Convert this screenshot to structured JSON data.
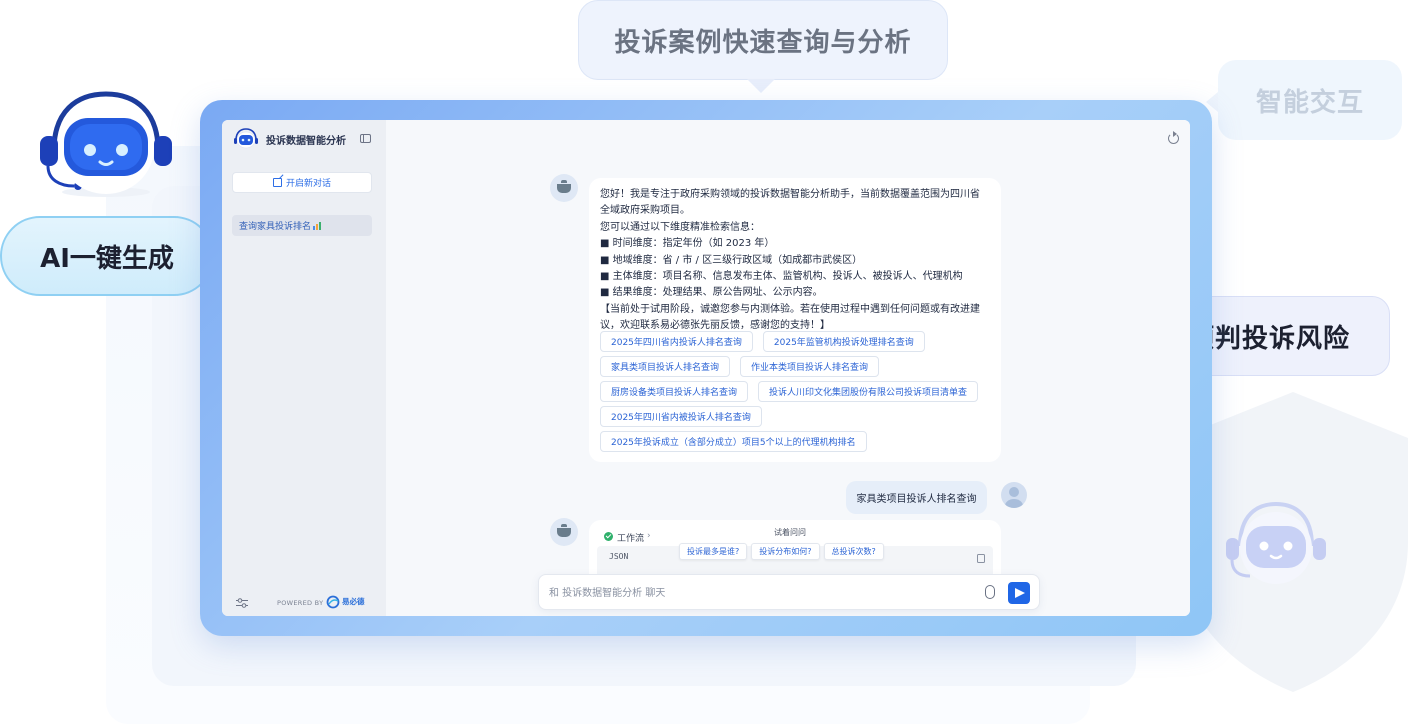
{
  "bubbles": {
    "top": "投诉案例快速查询与分析",
    "smart": "智能交互",
    "ai": "AI一键生成",
    "risk": "预判投诉风险"
  },
  "app": {
    "title": "投诉数据智能分析",
    "new_chat": "开启新对话",
    "history": [
      {
        "label": "查询家具投诉排名"
      }
    ],
    "powered_by": "POWERED BY",
    "brand": "易必德"
  },
  "chat": {
    "greeting": [
      "您好！我是专注于政府采购领域的投诉数据智能分析助手，当前数据覆盖范围为四川省",
      "全域政府采购项目。",
      "您可以通过以下维度精准检索信息：",
      "■ 时间维度：指定年份（如 2023 年）",
      "■ 地域维度：省 / 市 / 区三级行政区域（如成都市武侯区）",
      "■ 主体维度：项目名称、信息发布主体、监管机构、投诉人、被投诉人、代理机构",
      "■ 结果维度：处理结果、原公告网址、公示内容。",
      "【当前处于试用阶段，诚邀您参与内测体验。若在使用过程中遇到任何问题或有改进建",
      "议，欢迎联系易必德张先丽反馈，感谢您的支持！】"
    ],
    "suggestions": [
      [
        "2025年四川省内投诉人排名查询",
        "2025年监管机构投诉处理排名查询"
      ],
      [
        "家具类项目投诉人排名查询",
        "作业本类项目投诉人排名查询"
      ],
      [
        "厨房设备类项目投诉人排名查询",
        "投诉人川印文化集团股份有限公司投诉项目清单查"
      ],
      [
        "2025年四川省内被投诉人排名查询"
      ],
      [
        "2025年投诉成立（含部分成立）项目5个以上的代理机构排名"
      ]
    ],
    "user_message": "家具类项目投诉人排名查询",
    "workflow_label": "工作流",
    "try_ask_label": "试着问问",
    "try_ask": [
      "投诉最多是谁?",
      "投诉分布如何?",
      "总投诉次数?"
    ],
    "code_label": "JSON",
    "input_placeholder": "和 投诉数据智能分析 聊天"
  },
  "colors": {
    "accent": "#1f66e6",
    "link": "#2c64d5",
    "frame_gradient_start": "#7aa9f3",
    "frame_gradient_end": "#8fc6f6",
    "ai_bubble_border": "#8fd0f3",
    "success": "#2fb06b"
  },
  "icons": [
    "robot-mascot-icon",
    "bot-logo-icon",
    "sidebar-toggle-icon",
    "edit-icon",
    "bar-chart-icon",
    "settings-sliders-icon",
    "refresh-icon",
    "bot-avatar-icon",
    "user-avatar-icon",
    "check-circle-icon",
    "chevron-right-icon",
    "copy-icon",
    "paperclip-icon",
    "send-icon",
    "shield-icon"
  ]
}
